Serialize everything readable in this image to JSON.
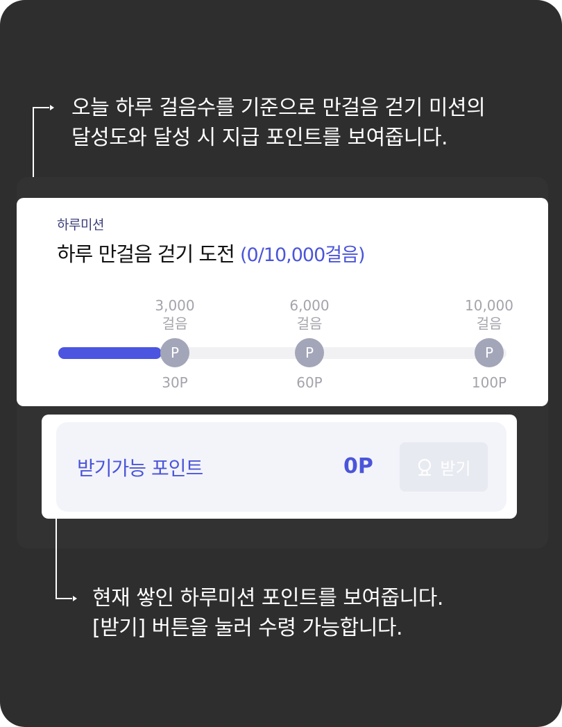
{
  "top_caption": {
    "line1": "오늘 하루 걸음수를 기준으로 만걸음 걷기 미션의",
    "line2": "달성도와 달성 시 지급 포인트를 보여줍니다."
  },
  "mission": {
    "eyebrow": "하루미션",
    "title": "하루 만걸음 걷기 도전",
    "count": "(0/10,000걸음)",
    "progress": 0.23,
    "milestones": [
      {
        "steps": "3,000",
        "unit": "걸음",
        "reward": "30P",
        "pin": "P"
      },
      {
        "steps": "6,000",
        "unit": "걸음",
        "reward": "60P",
        "pin": "P"
      },
      {
        "steps": "10,000",
        "unit": "걸음",
        "reward": "100P",
        "pin": "P"
      }
    ]
  },
  "points": {
    "label": "받기가능 포인트",
    "value": "0P",
    "button_label": "받기",
    "button_icon": "piggy-icon"
  },
  "bottom_caption": {
    "line1": "현재 쌓인 하루미션 포인트를 보여줍니다.",
    "line2": "[받기] 버튼을 눌러 수령 가능합니다."
  },
  "colors": {
    "accent": "#4b55d9",
    "background": "#2e2e2e",
    "pin": "#a3a5b9"
  }
}
